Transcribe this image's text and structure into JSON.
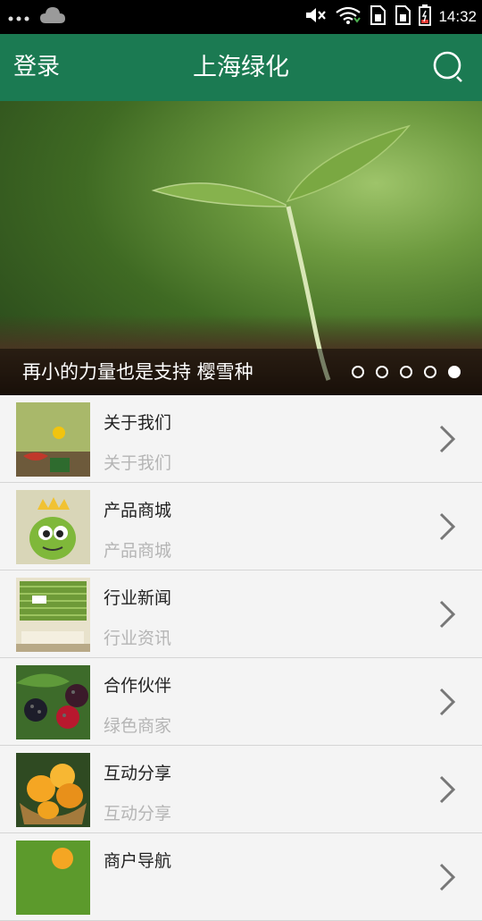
{
  "status_bar": {
    "time": "14:32",
    "icons": [
      "more-dots-icon",
      "cloud-icon",
      "mute-icon",
      "wifi-icon",
      "sim1-icon",
      "sim2-icon",
      "battery-icon"
    ]
  },
  "header": {
    "login_label": "登录",
    "title": "上海绿化",
    "search_icon": "search-icon"
  },
  "banner": {
    "caption": "再小的力量也是支持 樱雪种",
    "slide_count": 5,
    "active_index": 4
  },
  "list": {
    "items": [
      {
        "title": "关于我们",
        "subtitle": "关于我们",
        "icon": "chevron-right-icon"
      },
      {
        "title": "产品商城",
        "subtitle": "产品商城",
        "icon": "chevron-right-icon"
      },
      {
        "title": "行业新闻",
        "subtitle": "行业资讯",
        "icon": "chevron-right-icon"
      },
      {
        "title": "合作伙伴",
        "subtitle": "绿色商家",
        "icon": "chevron-right-icon"
      },
      {
        "title": "互动分享",
        "subtitle": "互动分享",
        "icon": "chevron-right-icon"
      },
      {
        "title": "商户导航",
        "subtitle": "",
        "icon": "chevron-right-icon"
      }
    ]
  },
  "colors": {
    "primary": "#1b7a52",
    "status_bar": "#000000",
    "list_bg": "#f4f4f4",
    "subtitle": "#b5b5b5"
  }
}
